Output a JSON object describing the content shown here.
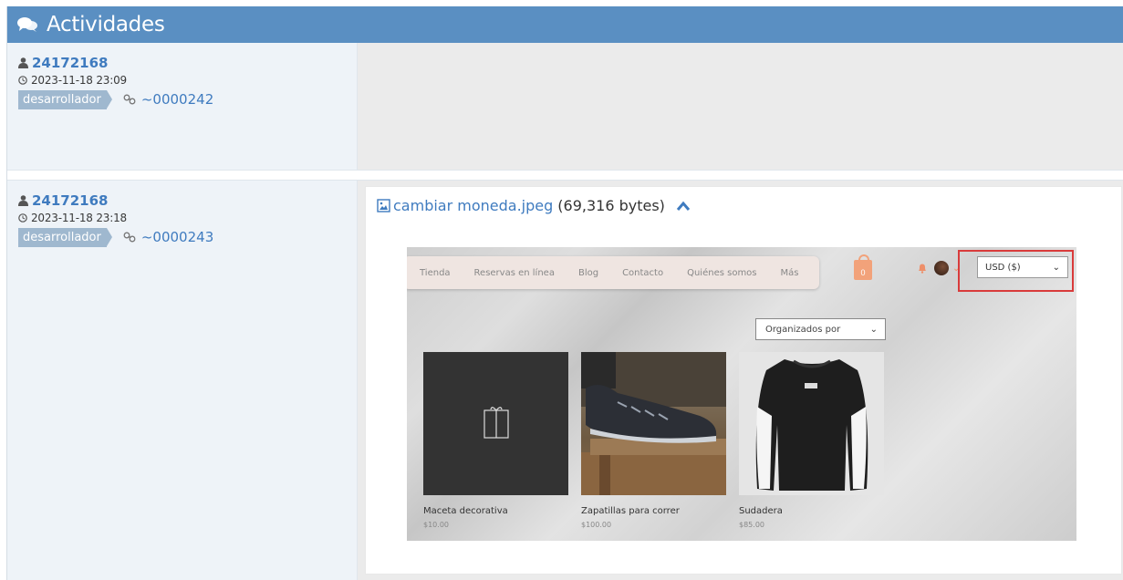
{
  "header": {
    "title": "Actividades",
    "icon": "comments-icon"
  },
  "activities": [
    {
      "user": "24172168",
      "date": "2023-11-18 23:09",
      "tag": "desarrollador",
      "link": "~0000242"
    },
    {
      "user": "24172168",
      "date": "2023-11-18 23:18",
      "tag": "desarrollador",
      "link": "~0000243"
    }
  ],
  "attachment": {
    "filename": "cambiar moneda.jpeg",
    "size": "(69,316 bytes)"
  },
  "screenshot": {
    "nav": [
      "Tienda",
      "Reservas en línea",
      "Blog",
      "Contacto",
      "Quiénes somos",
      "Más"
    ],
    "cart_count": "0",
    "currency": "USD ($)",
    "sort": "Organizados por",
    "products": [
      {
        "name": "Maceta decorativa",
        "price": "$10.00"
      },
      {
        "name": "Zapatillas para correr",
        "price": "$100.00"
      },
      {
        "name": "Sudadera",
        "price": "$85.00"
      }
    ]
  },
  "colors": {
    "header": "#5a8fc2",
    "link": "#3f7bbf",
    "tag": "#9fb8cf",
    "highlight": "#d93b3b"
  }
}
